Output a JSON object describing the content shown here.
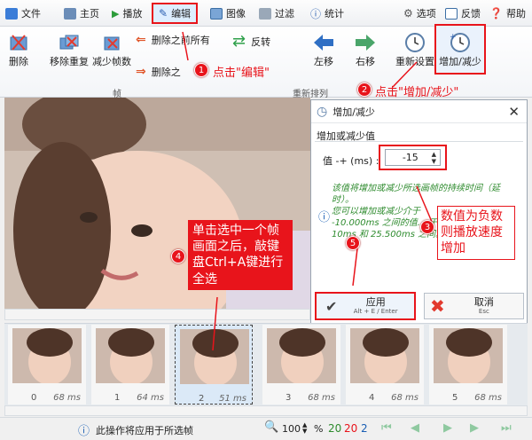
{
  "menu": {
    "file": "文件",
    "home": "主页",
    "play": "播放",
    "edit": "编辑",
    "image": "图像",
    "overlay": "过滤",
    "stats": "统计",
    "options": "选项",
    "feedback": "反馈",
    "help": "帮助"
  },
  "ribbon": {
    "delete": "删除",
    "remove_dup": "移除重复",
    "reduce_frames": "减少帧数",
    "delete_prev": "删除之前所有",
    "delete_next": "删除之",
    "reverse": "反转",
    "move_left": "左移",
    "move_right": "右移",
    "reset_delay": "重新设置",
    "incr_decr": "增加/减少",
    "group_frames": "帧",
    "group_reorder": "重新排列"
  },
  "dialog": {
    "title": "增加/减少",
    "section": "增加或减少值",
    "value_label": "值 -+ (ms) :",
    "value": "-15",
    "hint1": "该值将增加或减少所选画帧的持续时间（延时）。",
    "hint2": "您可以增加或减少介于 -10.000ms 之间的值... 于 10ms 和 25.500ms 之间。",
    "apply": "应用",
    "apply_shortcut": "Alt + E / Enter",
    "cancel": "取消",
    "cancel_shortcut": "Esc"
  },
  "frames": [
    {
      "index": "0",
      "delay": "68 ms"
    },
    {
      "index": "1",
      "delay": "64 ms"
    },
    {
      "index": "2",
      "delay": "51 ms"
    },
    {
      "index": "3",
      "delay": "68 ms"
    },
    {
      "index": "4",
      "delay": "68 ms"
    },
    {
      "index": "5",
      "delay": "68 ms"
    }
  ],
  "status": {
    "message": "此操作将应用于所选帧",
    "zoom": "100",
    "percent": "%",
    "total": "20",
    "selected": "20",
    "current": "2"
  },
  "annotations": {
    "step1": "点击\"编辑\"",
    "step2": "点击\"增加/减少\"",
    "step3": "数值为负数则播放速度增加",
    "step4": "单击选中一个帧画面之后，敲键盘Ctrl+A键进行全选",
    "n1": "1",
    "n2": "2",
    "n3": "3",
    "n4": "4",
    "n5": "5"
  },
  "colors": {
    "accent": "#e8141b",
    "hint_green": "#2e8b2e",
    "link_blue": "#1a5fb4"
  }
}
